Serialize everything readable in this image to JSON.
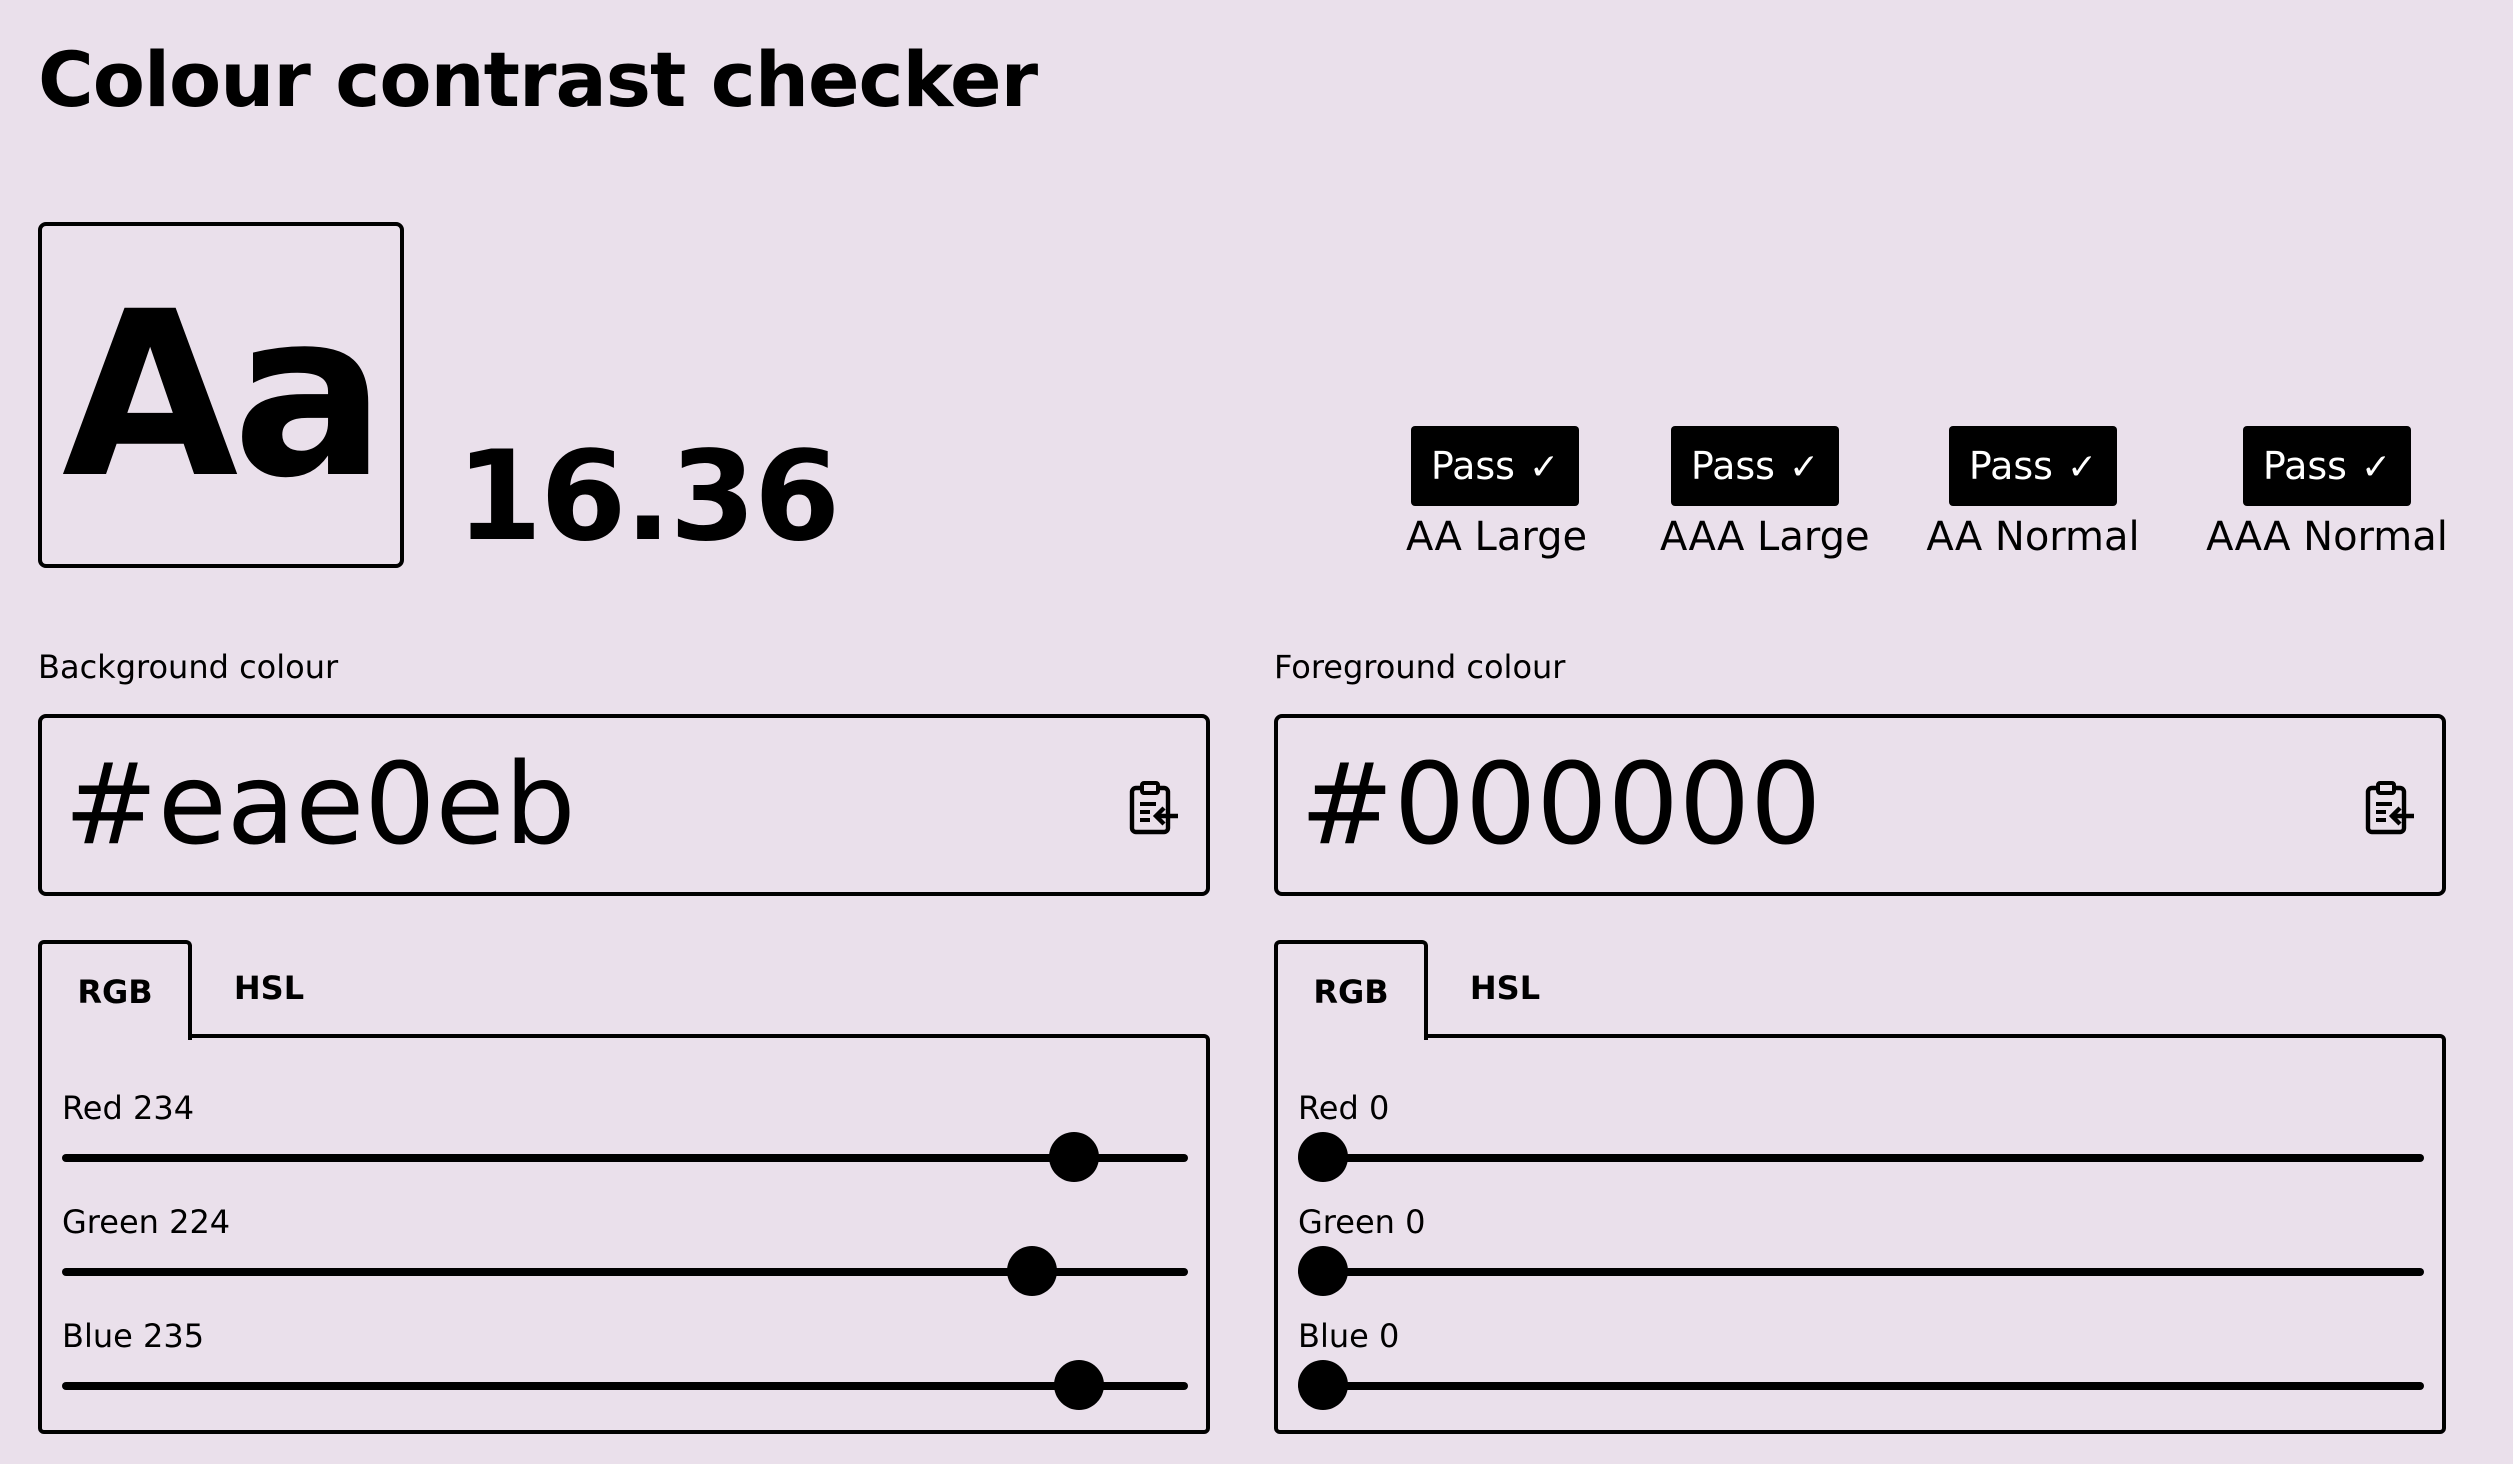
{
  "page": {
    "title": "Colour contrast checker"
  },
  "preview": {
    "text": "Aa"
  },
  "contrast": {
    "ratio": "16.36"
  },
  "results": [
    {
      "badge": "Pass",
      "label": "AA Large"
    },
    {
      "badge": "Pass",
      "label": "AAA Large"
    },
    {
      "badge": "Pass",
      "label": "AA Normal"
    },
    {
      "badge": "Pass",
      "label": "AAA Normal"
    }
  ],
  "background": {
    "label": "Background colour",
    "value": "#eae0eb",
    "tabs": [
      "RGB",
      "HSL"
    ],
    "active_tab": "RGB",
    "sliders": [
      {
        "label": "Red 234",
        "value": 234,
        "max": 255
      },
      {
        "label": "Green 224",
        "value": 224,
        "max": 255
      },
      {
        "label": "Blue 235",
        "value": 235,
        "max": 255
      }
    ]
  },
  "foreground": {
    "label": "Foreground colour",
    "value": "#000000",
    "tabs": [
      "RGB",
      "HSL"
    ],
    "active_tab": "RGB",
    "sliders": [
      {
        "label": "Red 0",
        "value": 0,
        "max": 255
      },
      {
        "label": "Green 0",
        "value": 0,
        "max": 255
      },
      {
        "label": "Blue 0",
        "value": 0,
        "max": 255
      }
    ]
  },
  "icons": {
    "check": "check-icon",
    "paste": "clipboard-paste-icon"
  },
  "colors": {
    "page_background": "#eae0eb",
    "text": "#000000",
    "badge_background": "#000000",
    "badge_text": "#ffffff"
  }
}
